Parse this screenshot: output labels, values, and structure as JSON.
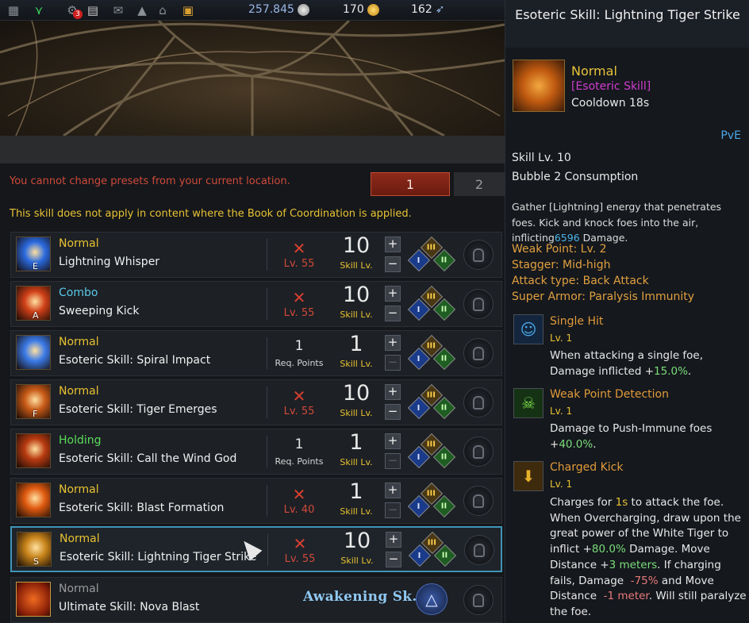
{
  "topbar": {
    "icons": [
      "calendar-icon",
      "wings-icon",
      "community-icon",
      "book-icon",
      "mail-icon",
      "bell-icon",
      "home-icon",
      "chest-icon"
    ],
    "notification_count": "3",
    "silver": "257.845",
    "gold": "170",
    "feathers": "162"
  },
  "warnings": {
    "location": "You cannot change presets from your current location.",
    "coordination": "This skill does not apply in content where the Book of Coordination is applied."
  },
  "presets": [
    "1",
    "2"
  ],
  "skills": [
    {
      "type": "Normal",
      "type_color": "#e8c232",
      "name": "Lightning Whisper",
      "key": "E",
      "req": "Lv. 55",
      "level": "10",
      "level_label": "Skill Lv.",
      "minus_enabled": true,
      "icon_color": "#2a6ae0"
    },
    {
      "type": "Combo",
      "type_color": "#5ac8e8",
      "name": "Sweeping Kick",
      "key": "A",
      "req": "Lv. 55",
      "level": "10",
      "level_label": "Skill Lv.",
      "minus_enabled": true,
      "icon_color": "#d04018"
    },
    {
      "type": "Normal",
      "type_color": "#e8c232",
      "name": "Esoteric Skill: Spiral Impact",
      "key": "",
      "req_points": "1",
      "req_label": "Req. Points",
      "level": "1",
      "level_label": "Skill Lv.",
      "minus_enabled": false,
      "icon_color": "#3a7ae8"
    },
    {
      "type": "Normal",
      "type_color": "#e8c232",
      "name": "Esoteric Skill: Tiger Emerges",
      "key": "F",
      "req": "Lv. 55",
      "level": "10",
      "level_label": "Skill Lv.",
      "minus_enabled": true,
      "icon_color": "#c85a18"
    },
    {
      "type": "Holding",
      "type_color": "#5ade5a",
      "name": "Esoteric Skill: Call the Wind God",
      "key": "",
      "req_points": "1",
      "req_label": "Req. Points",
      "level": "1",
      "level_label": "Skill Lv.",
      "minus_enabled": false,
      "icon_color": "#b83a10"
    },
    {
      "type": "Normal",
      "type_color": "#e8c232",
      "name": "Esoteric Skill: Blast Formation",
      "key": "",
      "req": "Lv. 40",
      "level": "1",
      "level_label": "Skill Lv.",
      "minus_enabled": false,
      "icon_color": "#e05a10"
    },
    {
      "type": "Normal",
      "type_color": "#e8c232",
      "name": "Esoteric Skill: Lightning Tiger Strike",
      "key": "S",
      "req": "Lv. 55",
      "level": "10",
      "level_label": "Skill Lv.",
      "minus_enabled": true,
      "icon_color": "#c8841a"
    }
  ],
  "awakening": {
    "type": "Normal",
    "name": "Ultimate Skill: Nova Blast",
    "label": "Awakening Sk."
  },
  "tripod_labels": {
    "one": "I",
    "two": "II",
    "three": "III"
  },
  "tooltip": {
    "title": "Esoteric Skill: Lightning Tiger Strike",
    "grade": "Normal",
    "tag": "[Esoteric Skill]",
    "cooldown": "Cooldown 18s",
    "mode": "PvE",
    "skill_level": "Skill Lv. 10",
    "bubble": "Bubble 2 Consumption",
    "description_pre": "Gather [Lightning] energy that penetrates foes. Kick and knock foes into the air, inflicting",
    "description_dmg": "6596",
    "description_post": " Damage.",
    "properties": [
      "Weak Point: Lv. 2",
      "Stagger: Mid-high",
      "Attack type: Back Attack",
      "Super Armor: Paralysis Immunity"
    ],
    "tripods": [
      {
        "name": "Single Hit",
        "level": "Lv. 1",
        "icon": "person-icon"
      },
      {
        "name": "Weak Point Detection",
        "level": "Lv. 1",
        "icon": "monster-icon"
      },
      {
        "name": "Charged Kick",
        "level": "Lv. 1",
        "icon": "arrow-down-icon"
      }
    ]
  }
}
